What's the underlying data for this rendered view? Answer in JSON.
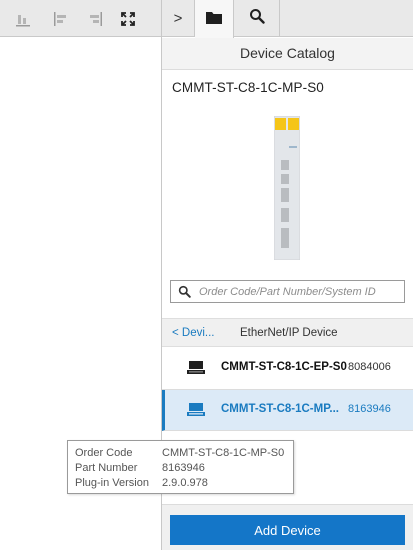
{
  "left_toolbar": {
    "icons": [
      "align-bottom-icon",
      "align-left-icon",
      "align-right-icon",
      "fit-to-screen-icon"
    ]
  },
  "tabs": {
    "collapse_label": ">",
    "folder": "folder-icon",
    "search": "search-icon"
  },
  "catalog": {
    "title": "Device Catalog",
    "selected_device_name": "CMMT-ST-C8-1C-MP-S0",
    "search_placeholder": "Order Code/Part Number/System ID",
    "breadcrumb_back": "< Devi...",
    "breadcrumb_current": "EtherNet/IP Device",
    "items": [
      {
        "name": "CMMT-ST-C8-1C-EP-S0",
        "number": "8084006",
        "icon": "drive-icon",
        "selected": false
      },
      {
        "name": "CMMT-ST-C8-1C-MP...",
        "number": "8163946",
        "icon": "drive-icon",
        "selected": true
      }
    ],
    "add_button_label": "Add Device"
  },
  "tooltip": {
    "order_code_label": "Order Code",
    "order_code_value": "CMMT-ST-C8-1C-MP-S0",
    "part_number_label": "Part Number",
    "part_number_value": "8163946",
    "plugin_version_label": "Plug-in Version",
    "plugin_version_value": "2.9.0.978"
  },
  "colors": {
    "accent": "#1476c8",
    "selected_bg": "#dceaf7",
    "link": "#1a7bc0",
    "device_yellow": "#f5c518"
  }
}
